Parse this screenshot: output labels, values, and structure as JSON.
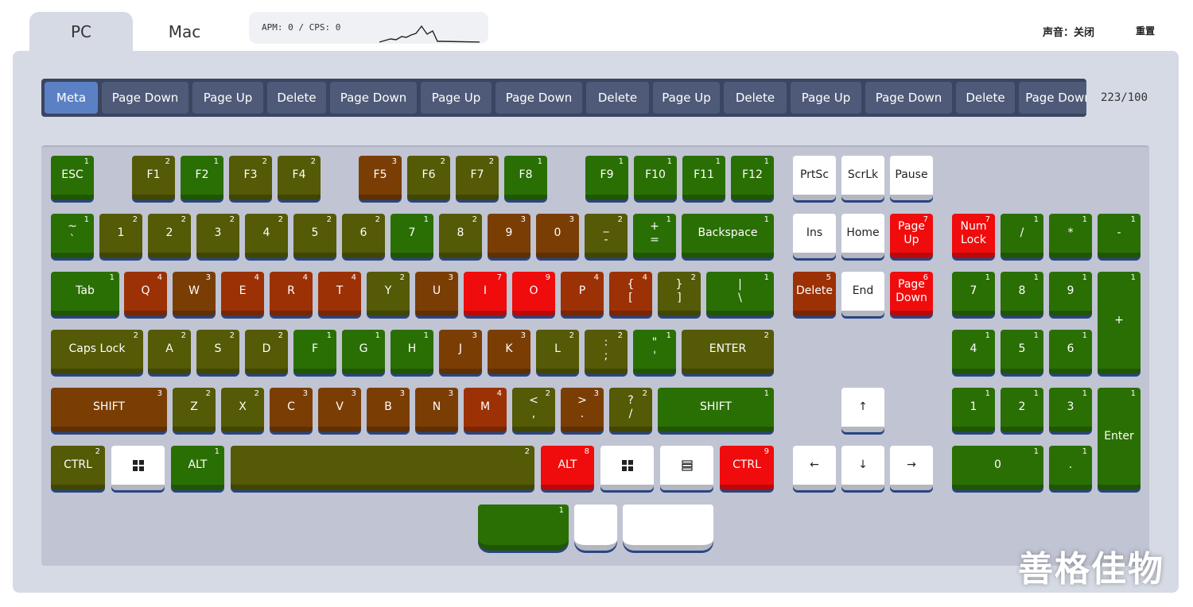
{
  "tabs": [
    {
      "label": "PC",
      "active": true
    },
    {
      "label": "Mac",
      "active": false
    }
  ],
  "apm": {
    "text": "APM: 0 / CPS: 0"
  },
  "header": {
    "sound_label": "声音：关闭",
    "reset_label": "重置"
  },
  "history": {
    "count": "223/100",
    "items": [
      "Meta",
      "Page Down",
      "Page Up",
      "Delete",
      "Page Down",
      "Page Up",
      "Page Down",
      "Delete",
      "Page Up",
      "Delete",
      "Page Up",
      "Page Down",
      "Delete",
      "Page Down"
    ]
  },
  "colors": {
    "green": "#2a6f04",
    "olive": "#545a05",
    "brown": "#7a3e05",
    "rust": "#9c3105",
    "red": "#f00c0c",
    "white": "#ffffff",
    "keyshadow": "#294584",
    "panel": "#d6dae4",
    "keyboard_bg": "#c1c4d2",
    "history_bg": "#3a4661",
    "chip": "#4e5a77",
    "chip_active": "#5b80c4"
  },
  "keys": [
    {
      "id": "esc",
      "label": "ESC",
      "count": "1",
      "color": "green"
    },
    {
      "id": "f1",
      "label": "F1",
      "count": "2",
      "color": "olive"
    },
    {
      "id": "f2",
      "label": "F2",
      "count": "1",
      "color": "green"
    },
    {
      "id": "f3",
      "label": "F3",
      "count": "2",
      "color": "olive"
    },
    {
      "id": "f4",
      "label": "F4",
      "count": "2",
      "color": "olive"
    },
    {
      "id": "f5",
      "label": "F5",
      "count": "3",
      "color": "brown"
    },
    {
      "id": "f6",
      "label": "F6",
      "count": "2",
      "color": "olive"
    },
    {
      "id": "f7",
      "label": "F7",
      "count": "2",
      "color": "olive"
    },
    {
      "id": "f8",
      "label": "F8",
      "count": "1",
      "color": "green"
    },
    {
      "id": "f9",
      "label": "F9",
      "count": "1",
      "color": "green"
    },
    {
      "id": "f10",
      "label": "F10",
      "count": "1",
      "color": "green"
    },
    {
      "id": "f11",
      "label": "F11",
      "count": "1",
      "color": "green"
    },
    {
      "id": "f12",
      "label": "F12",
      "count": "1",
      "color": "green"
    },
    {
      "id": "prtsc",
      "label": "PrtSc",
      "count": "",
      "color": "white"
    },
    {
      "id": "scrlk",
      "label": "ScrLk",
      "count": "",
      "color": "white"
    },
    {
      "id": "pause",
      "label": "Pause",
      "count": "",
      "color": "white"
    },
    {
      "id": "tilde",
      "label": "~\n`",
      "count": "1",
      "color": "green"
    },
    {
      "id": "d1",
      "label": "1",
      "count": "2",
      "color": "olive"
    },
    {
      "id": "d2",
      "label": "2",
      "count": "2",
      "color": "olive"
    },
    {
      "id": "d3",
      "label": "3",
      "count": "2",
      "color": "olive"
    },
    {
      "id": "d4",
      "label": "4",
      "count": "2",
      "color": "olive"
    },
    {
      "id": "d5",
      "label": "5",
      "count": "2",
      "color": "olive"
    },
    {
      "id": "d6",
      "label": "6",
      "count": "2",
      "color": "olive"
    },
    {
      "id": "d7",
      "label": "7",
      "count": "1",
      "color": "green"
    },
    {
      "id": "d8",
      "label": "8",
      "count": "2",
      "color": "olive"
    },
    {
      "id": "d9",
      "label": "9",
      "count": "3",
      "color": "brown"
    },
    {
      "id": "d0",
      "label": "0",
      "count": "3",
      "color": "brown"
    },
    {
      "id": "minus",
      "label": "_\n-",
      "count": "2",
      "color": "olive"
    },
    {
      "id": "equal",
      "label": "+\n=",
      "count": "1",
      "color": "green"
    },
    {
      "id": "backspace",
      "label": "Backspace",
      "count": "1",
      "color": "green"
    },
    {
      "id": "ins",
      "label": "Ins",
      "count": "",
      "color": "white"
    },
    {
      "id": "home",
      "label": "Home",
      "count": "",
      "color": "white"
    },
    {
      "id": "pgup",
      "label": "Page\nUp",
      "count": "7",
      "color": "red"
    },
    {
      "id": "numlock",
      "label": "Num\nLock",
      "count": "7",
      "color": "red"
    },
    {
      "id": "npslash",
      "label": "/",
      "count": "1",
      "color": "green"
    },
    {
      "id": "npstar",
      "label": "*",
      "count": "1",
      "color": "green"
    },
    {
      "id": "npminus",
      "label": "-",
      "count": "1",
      "color": "green"
    },
    {
      "id": "tab",
      "label": "Tab",
      "count": "1",
      "color": "green"
    },
    {
      "id": "q",
      "label": "Q",
      "count": "4",
      "color": "rust"
    },
    {
      "id": "w",
      "label": "W",
      "count": "3",
      "color": "brown"
    },
    {
      "id": "e",
      "label": "E",
      "count": "4",
      "color": "rust"
    },
    {
      "id": "r",
      "label": "R",
      "count": "4",
      "color": "rust"
    },
    {
      "id": "t",
      "label": "T",
      "count": "4",
      "color": "rust"
    },
    {
      "id": "y",
      "label": "Y",
      "count": "2",
      "color": "olive"
    },
    {
      "id": "u",
      "label": "U",
      "count": "3",
      "color": "brown"
    },
    {
      "id": "i",
      "label": "I",
      "count": "7",
      "color": "red"
    },
    {
      "id": "o",
      "label": "O",
      "count": "9",
      "color": "red"
    },
    {
      "id": "p",
      "label": "P",
      "count": "4",
      "color": "rust"
    },
    {
      "id": "lbrace",
      "label": "{\n[",
      "count": "4",
      "color": "rust"
    },
    {
      "id": "rbrace",
      "label": "}\n]",
      "count": "2",
      "color": "olive"
    },
    {
      "id": "backslash",
      "label": "|\n\\",
      "count": "1",
      "color": "green"
    },
    {
      "id": "delete",
      "label": "Delete",
      "count": "5",
      "color": "rust"
    },
    {
      "id": "end",
      "label": "End",
      "count": "",
      "color": "white"
    },
    {
      "id": "pgdn",
      "label": "Page\nDown",
      "count": "6",
      "color": "red"
    },
    {
      "id": "np7",
      "label": "7",
      "count": "1",
      "color": "green"
    },
    {
      "id": "np8",
      "label": "8",
      "count": "1",
      "color": "green"
    },
    {
      "id": "np9",
      "label": "9",
      "count": "1",
      "color": "green"
    },
    {
      "id": "npplus",
      "label": "+",
      "count": "1",
      "color": "green"
    },
    {
      "id": "caps",
      "label": "Caps Lock",
      "count": "2",
      "color": "olive"
    },
    {
      "id": "a",
      "label": "A",
      "count": "2",
      "color": "olive"
    },
    {
      "id": "s",
      "label": "S",
      "count": "2",
      "color": "olive"
    },
    {
      "id": "d",
      "label": "D",
      "count": "2",
      "color": "olive"
    },
    {
      "id": "f",
      "label": "F",
      "count": "1",
      "color": "green"
    },
    {
      "id": "g",
      "label": "G",
      "count": "1",
      "color": "green"
    },
    {
      "id": "h",
      "label": "H",
      "count": "1",
      "color": "green"
    },
    {
      "id": "j",
      "label": "J",
      "count": "3",
      "color": "brown"
    },
    {
      "id": "k",
      "label": "K",
      "count": "3",
      "color": "brown"
    },
    {
      "id": "l",
      "label": "L",
      "count": "2",
      "color": "olive"
    },
    {
      "id": "semicolon",
      "label": ":\n;",
      "count": "2",
      "color": "olive"
    },
    {
      "id": "quote",
      "label": "\"\n'",
      "count": "1",
      "color": "green"
    },
    {
      "id": "enter",
      "label": "ENTER",
      "count": "2",
      "color": "olive"
    },
    {
      "id": "np4",
      "label": "4",
      "count": "1",
      "color": "green"
    },
    {
      "id": "np5",
      "label": "5",
      "count": "1",
      "color": "green"
    },
    {
      "id": "np6",
      "label": "6",
      "count": "1",
      "color": "green"
    },
    {
      "id": "lshift",
      "label": "SHIFT",
      "count": "3",
      "color": "brown"
    },
    {
      "id": "z",
      "label": "Z",
      "count": "2",
      "color": "olive"
    },
    {
      "id": "x",
      "label": "X",
      "count": "2",
      "color": "olive"
    },
    {
      "id": "c",
      "label": "C",
      "count": "3",
      "color": "brown"
    },
    {
      "id": "v",
      "label": "V",
      "count": "3",
      "color": "brown"
    },
    {
      "id": "b",
      "label": "B",
      "count": "3",
      "color": "brown"
    },
    {
      "id": "n",
      "label": "N",
      "count": "3",
      "color": "brown"
    },
    {
      "id": "m",
      "label": "M",
      "count": "4",
      "color": "rust"
    },
    {
      "id": "comma",
      "label": "<\n,",
      "count": "2",
      "color": "olive"
    },
    {
      "id": "period",
      "label": ">\n.",
      "count": "3",
      "color": "brown"
    },
    {
      "id": "slash",
      "label": "?\n/",
      "count": "2",
      "color": "olive"
    },
    {
      "id": "rshift",
      "label": "SHIFT",
      "count": "1",
      "color": "green"
    },
    {
      "id": "up",
      "label": "↑",
      "count": "",
      "color": "white"
    },
    {
      "id": "np1",
      "label": "1",
      "count": "1",
      "color": "green"
    },
    {
      "id": "np2",
      "label": "2",
      "count": "1",
      "color": "green"
    },
    {
      "id": "np3",
      "label": "3",
      "count": "1",
      "color": "green"
    },
    {
      "id": "npenter",
      "label": "Enter",
      "count": "1",
      "color": "green"
    },
    {
      "id": "lctrl",
      "label": "CTRL",
      "count": "2",
      "color": "olive"
    },
    {
      "id": "lwin",
      "label": "",
      "count": "",
      "color": "white",
      "icon": "windows-icon"
    },
    {
      "id": "lalt",
      "label": "ALT",
      "count": "1",
      "color": "green"
    },
    {
      "id": "space",
      "label": "",
      "count": "2",
      "color": "olive"
    },
    {
      "id": "ralt",
      "label": "ALT",
      "count": "8",
      "color": "red"
    },
    {
      "id": "rwin",
      "label": "",
      "count": "",
      "color": "white",
      "icon": "windows-icon"
    },
    {
      "id": "menu",
      "label": "",
      "count": "",
      "color": "white",
      "icon": "menu-icon"
    },
    {
      "id": "rctrl",
      "label": "CTRL",
      "count": "9",
      "color": "red"
    },
    {
      "id": "left",
      "label": "←",
      "count": "",
      "color": "white"
    },
    {
      "id": "down",
      "label": "↓",
      "count": "",
      "color": "white"
    },
    {
      "id": "right",
      "label": "→",
      "count": "",
      "color": "white"
    },
    {
      "id": "np0",
      "label": "0",
      "count": "1",
      "color": "green"
    },
    {
      "id": "npdot",
      "label": ".",
      "count": "1",
      "color": "green"
    },
    {
      "id": "mouse-left",
      "label": "",
      "count": "1",
      "color": "green"
    },
    {
      "id": "mouse-middle",
      "label": "",
      "count": "",
      "color": "white"
    },
    {
      "id": "mouse-right",
      "label": "",
      "count": "",
      "color": "white"
    }
  ],
  "watermark": "善格佳物"
}
